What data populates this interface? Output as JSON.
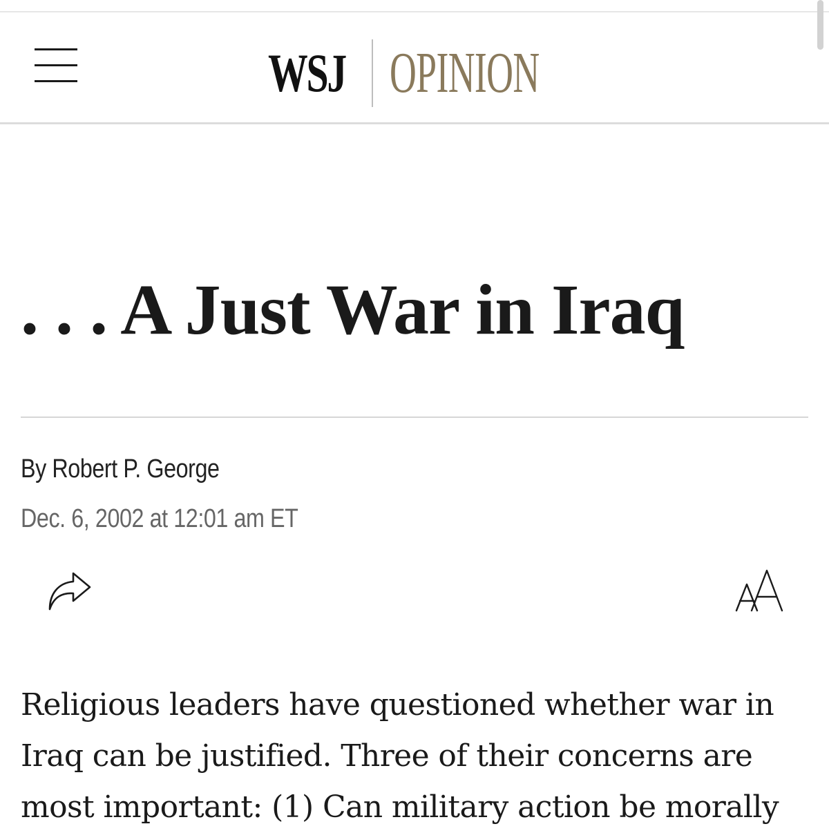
{
  "header": {
    "logo_wsj": "WSJ",
    "logo_section": "OPINION",
    "section_color": "#8a7a5c",
    "menu_icon": "hamburger-menu-icon"
  },
  "article": {
    "headline": ". . . A Just War in Iraq",
    "byline": "By Robert P. George",
    "dateline": "Dec. 6, 2002 at 12:01 am ET",
    "body": "Religious leaders have questioned whether war in Iraq can be justified. Three of their concerns are most important: (1) Can military action be morally"
  },
  "toolbar": {
    "share_icon": "share-arrow-icon",
    "text_size_icon": "text-size-icon"
  }
}
